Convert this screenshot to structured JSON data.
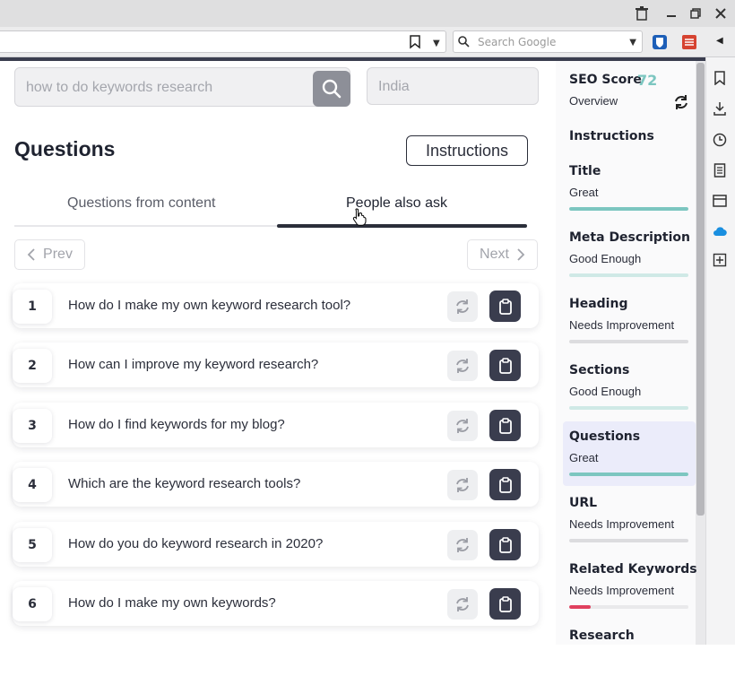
{
  "browser": {
    "search_placeholder": "Search Google"
  },
  "main": {
    "search_placeholder": "how to do keywords research",
    "country_placeholder": "India",
    "section_title": "Questions",
    "instructions_label": "Instructions",
    "tabs": [
      {
        "label": "Questions from content",
        "active": false
      },
      {
        "label": "People also ask",
        "active": true
      }
    ],
    "prev_label": "Prev",
    "next_label": "Next",
    "questions": [
      {
        "num": "1",
        "text": "How do I make my own keyword research tool?"
      },
      {
        "num": "2",
        "text": "How can I improve my keyword research?"
      },
      {
        "num": "3",
        "text": "How do I find keywords for my blog?"
      },
      {
        "num": "4",
        "text": "Which are the keyword research tools?"
      },
      {
        "num": "5",
        "text": "How do you do keyword research in 2020?"
      },
      {
        "num": "6",
        "text": "How do I make my own keywords?"
      }
    ]
  },
  "seo": {
    "title": "SEO Score",
    "score": "72",
    "overview": "Overview",
    "instructions": "Instructions",
    "colors": {
      "great": "#7cc6c0",
      "good": "#cfe9e6",
      "poor": "#d8d8dc",
      "bad": "#e0405e"
    },
    "items": [
      {
        "name": "Title",
        "status": "Great",
        "level": 1.0,
        "color": "#7cc6c0",
        "active": false
      },
      {
        "name": "Meta Description",
        "status": "Good Enough",
        "level": 1.0,
        "color": "#cfe9e6",
        "active": false
      },
      {
        "name": "Heading",
        "status": "Needs Improvement",
        "level": 1.0,
        "color": "#dcdcdf",
        "active": false
      },
      {
        "name": "Sections",
        "status": "Good Enough",
        "level": 1.0,
        "color": "#cfe9e6",
        "active": false
      },
      {
        "name": "Questions",
        "status": "Great",
        "level": 1.0,
        "color": "#7cc6c0",
        "active": true
      },
      {
        "name": "URL",
        "status": "Needs Improvement",
        "level": 1.0,
        "color": "#dcdcdf",
        "active": false
      },
      {
        "name": "Related Keywords",
        "status": "Needs Improvement",
        "level": 0.18,
        "color": "#e0405e",
        "active": false
      },
      {
        "name": "Research",
        "status": "",
        "level": 0,
        "color": "#dcdcdf",
        "active": false
      }
    ]
  }
}
